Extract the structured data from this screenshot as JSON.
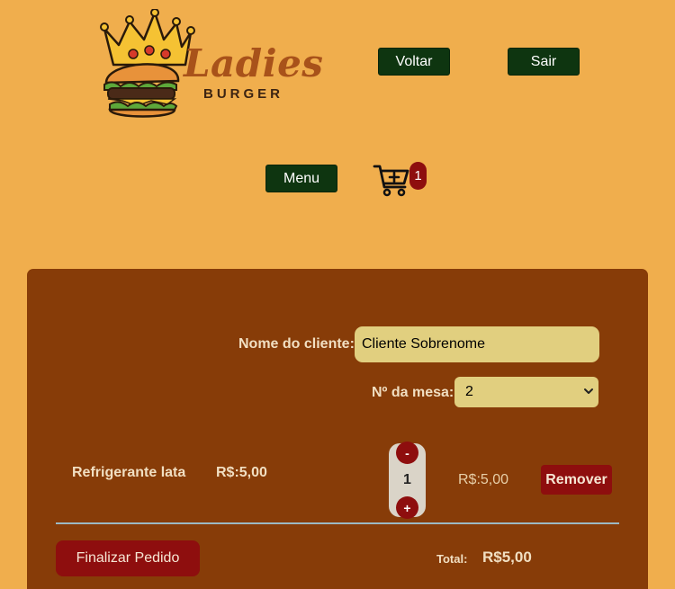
{
  "header": {
    "logo_word": "Ladies",
    "logo_sub": "BURGER",
    "back_label": "Voltar",
    "logout_label": "Sair",
    "menu_label": "Menu",
    "cart_count": "1"
  },
  "order": {
    "client_label": "Nome do cliente:",
    "client_value": "Cliente Sobrenome",
    "table_label": "Nº da mesa:",
    "table_value": "2",
    "items": [
      {
        "name": "Refrigerante lata",
        "unit_price": "R$:5,00",
        "quantity": "1",
        "line_price": "R$:5,00",
        "remove_label": "Remover",
        "minus_label": "-",
        "plus_label": "+"
      }
    ],
    "finalize_label": "Finalizar Pedido",
    "total_label": "Total:",
    "total_value": "R$5,00"
  },
  "colors": {
    "background": "#F0AE4D",
    "panel": "#873C08",
    "dark_button": "#0E3510",
    "accent_red": "#8E0E0E",
    "input_bg": "#E1CF7F"
  },
  "icons": [
    "crown-icon",
    "burger-icon",
    "cart-plus-icon",
    "chevron-down-icon"
  ]
}
